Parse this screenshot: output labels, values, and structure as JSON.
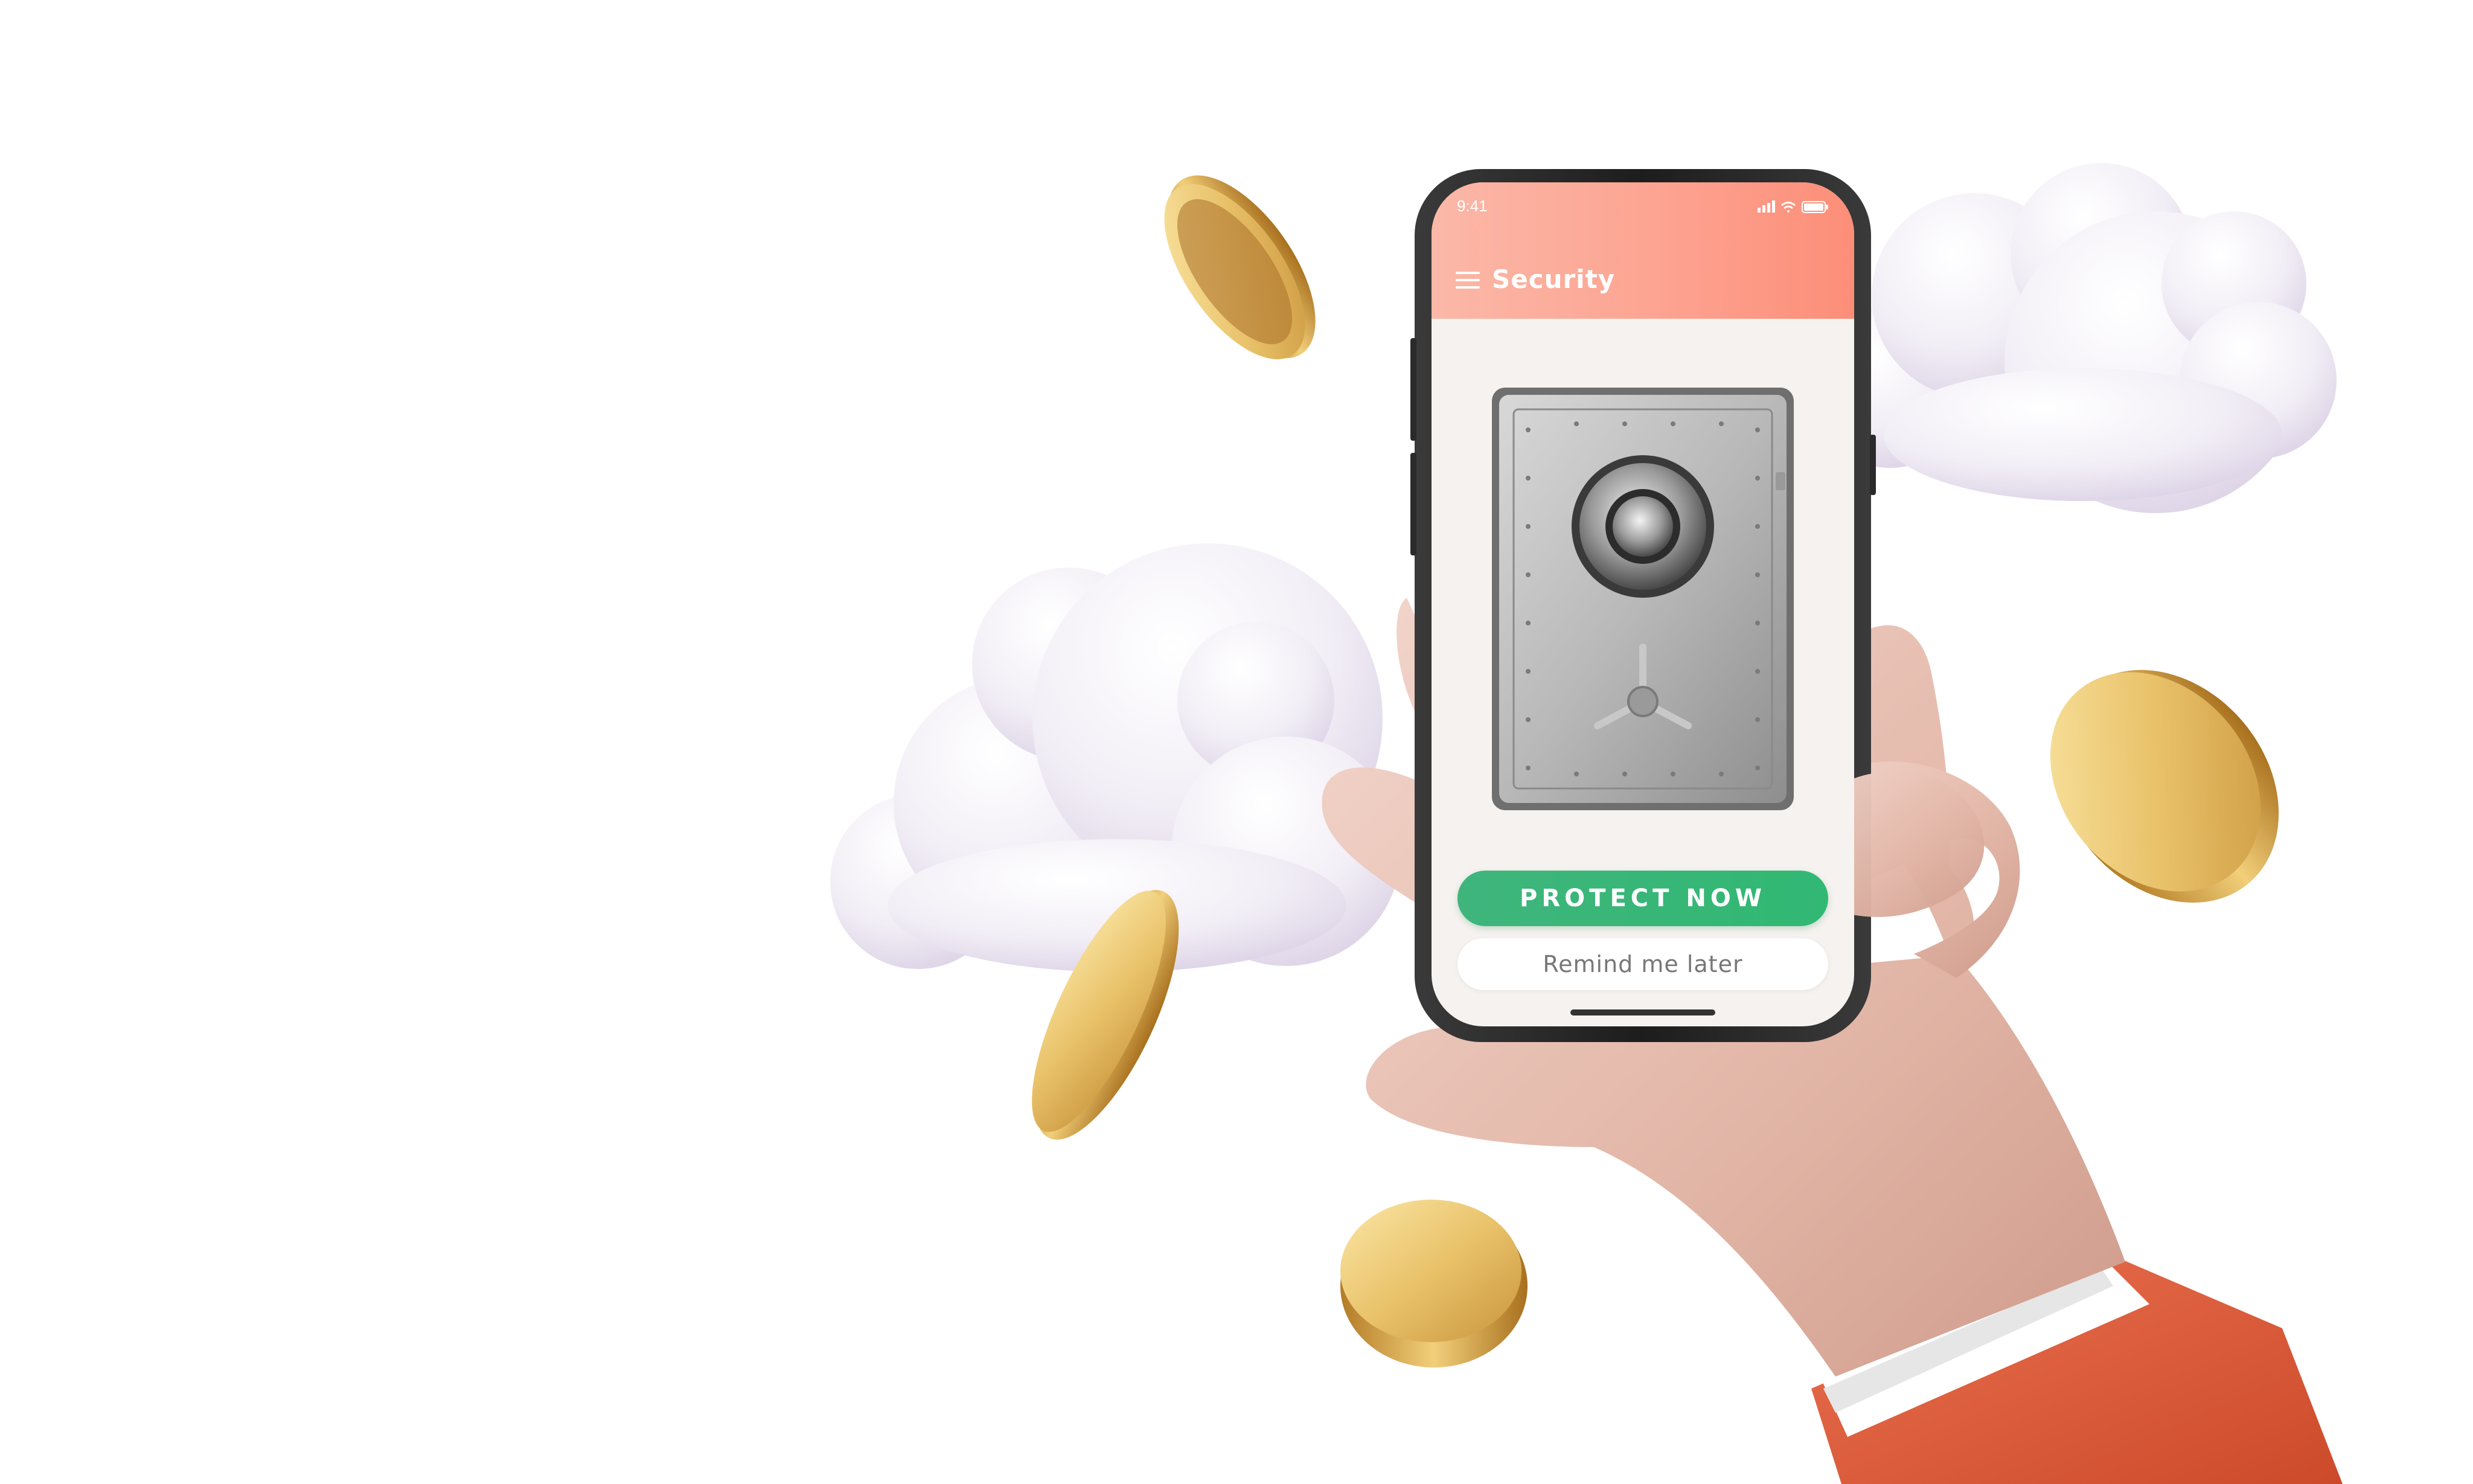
{
  "status_bar": {
    "time": "9:41"
  },
  "app_bar": {
    "title": "Security",
    "menu_icon": "hamburger-menu-icon"
  },
  "content": {
    "hero_image": "bank-safe-illustration"
  },
  "actions": {
    "primary_label": "PROTECT NOW",
    "secondary_label": "Remind me later"
  },
  "colors": {
    "header_start": "#fbb8a8",
    "header_end": "#fc8e78",
    "primary_button": "#3fb57c",
    "screen_background": "#f5f2ef",
    "sleeve": "#e1603d"
  }
}
